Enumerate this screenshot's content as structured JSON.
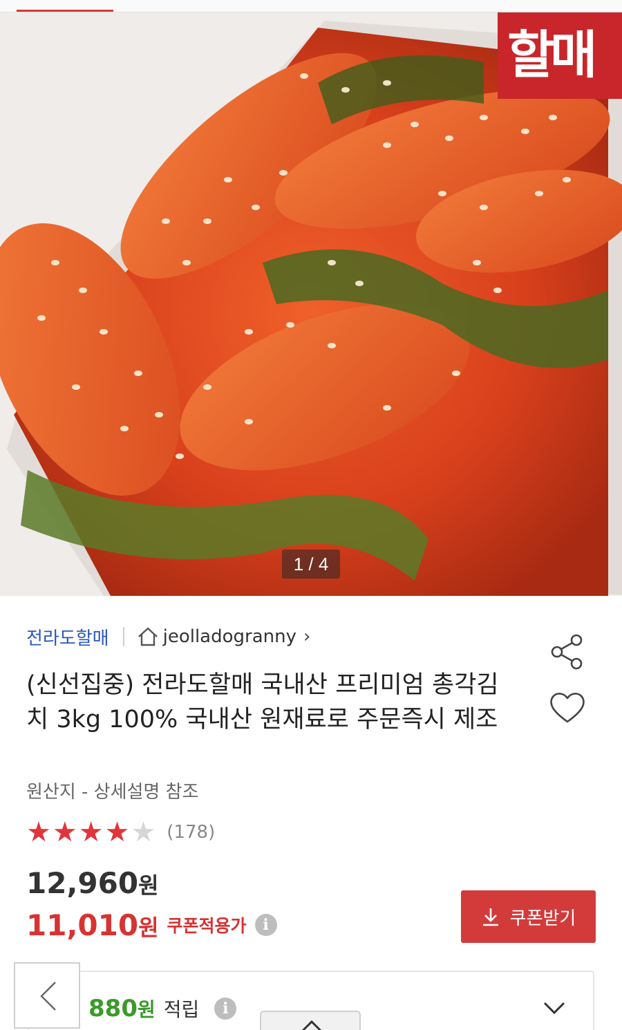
{
  "hero": {
    "image_alt": "총각김치",
    "brand_stamp_text": "할매",
    "page_indicator": "1 / 4"
  },
  "product": {
    "seller_name": "전라도할매",
    "store_id": "jeolladogranny",
    "title": "(신선집중) 전라도할매 국내산 프리미엄 총각김치 3kg 100% 국내산 원재료로 주문즉시 제조",
    "origin": "원산지 - 상세설명 참조",
    "rating": 4,
    "rating_max": 5,
    "review_count": "(178)"
  },
  "pricing": {
    "original_price": "12,960",
    "coupon_price": "11,010",
    "currency": "원",
    "coupon_label": "쿠폰적용가",
    "coupon_button": "쿠폰받기"
  },
  "points": {
    "amount": "880",
    "currency": "원",
    "label": "적립"
  },
  "icons": {
    "home": "home-icon",
    "chevron_right": "chevron-right-icon",
    "share": "share-icon",
    "heart": "heart-icon",
    "info": "info-icon",
    "download": "download-icon",
    "chevron_down": "chevron-down-icon",
    "chevron_left": "chevron-left-icon",
    "chevron_up": "chevron-up-icon"
  },
  "colors": {
    "accent_red": "#d33b3b",
    "seller_blue": "#2a56b8",
    "points_green": "#3a9a2a",
    "star_red": "#e0353b"
  }
}
